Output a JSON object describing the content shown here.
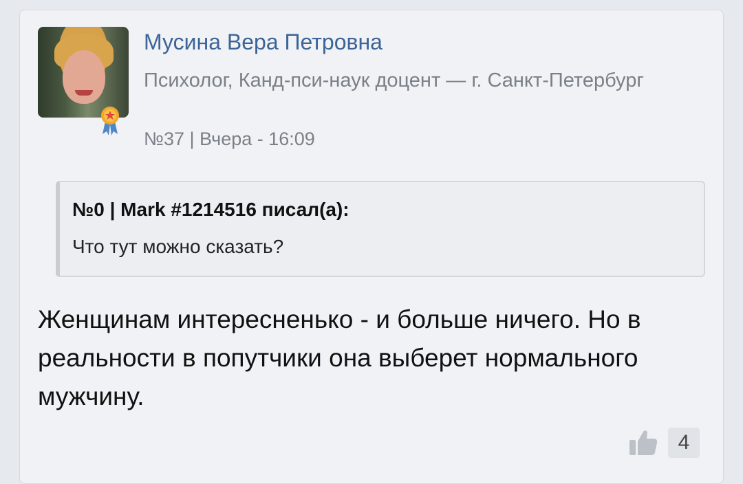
{
  "post": {
    "author": {
      "name": "Мусина Вера Петровна",
      "role": "Психолог, Канд-пси-наук доцент — г. Санкт-Петербург"
    },
    "meta": "№37 | Вчера - 16:09",
    "quote": {
      "header": "№0 | Mark #1214516 писал(а):",
      "text": "Что тут можно сказать?"
    },
    "body": "Женщинам интересненько - и больше ничего. Но в реальности в попутчики она выберет нормального мужчину.",
    "likes": "4"
  },
  "icons": {
    "badge": "award-ribbon-icon",
    "like": "thumbs-up-icon"
  },
  "colors": {
    "author_name": "#3c6497",
    "meta_text": "#7b8088",
    "card_bg": "#f0f2f5",
    "badge_gold": "#f0a92a",
    "badge_ribbon": "#4f86c6"
  }
}
